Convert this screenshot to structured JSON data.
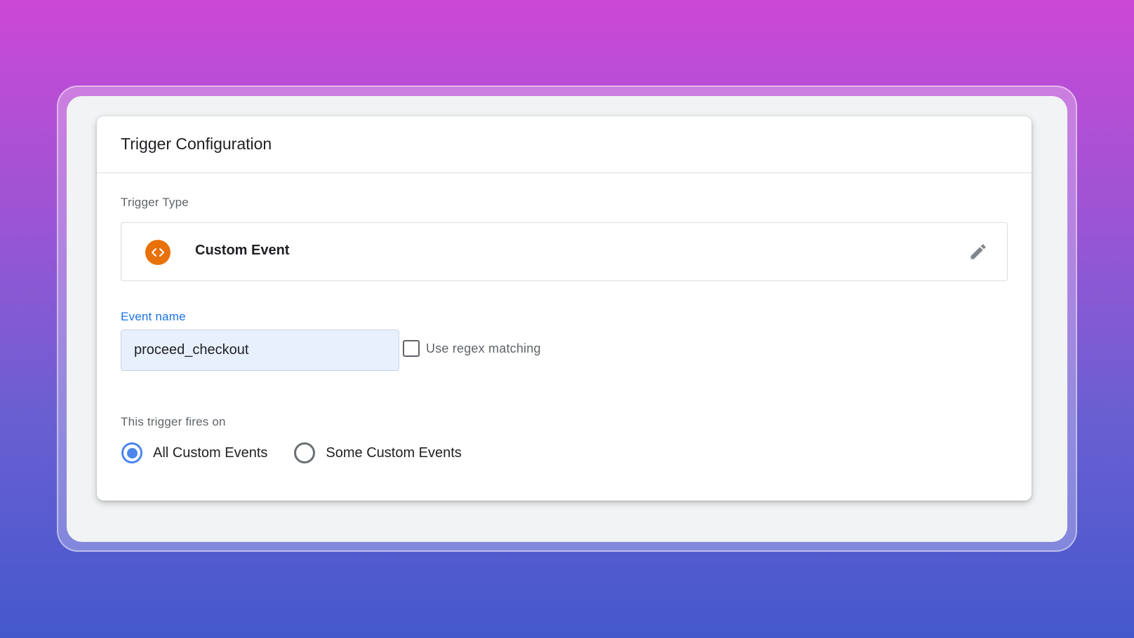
{
  "header": {
    "title": "Trigger Configuration"
  },
  "trigger_type": {
    "label": "Trigger Type",
    "name": "Custom Event",
    "icon": "code-brackets-icon",
    "icon_color": "#e8710a",
    "edit_icon": "pencil-icon"
  },
  "event_name": {
    "label": "Event name",
    "value": "proceed_checkout",
    "label_color": "#1a73e8"
  },
  "regex": {
    "label": "Use regex matching",
    "checked": false
  },
  "fires_on": {
    "label": "This trigger fires on",
    "options": [
      {
        "label": "All Custom Events",
        "selected": true
      },
      {
        "label": "Some Custom Events",
        "selected": false
      }
    ],
    "accent_color": "#4a86ec"
  }
}
